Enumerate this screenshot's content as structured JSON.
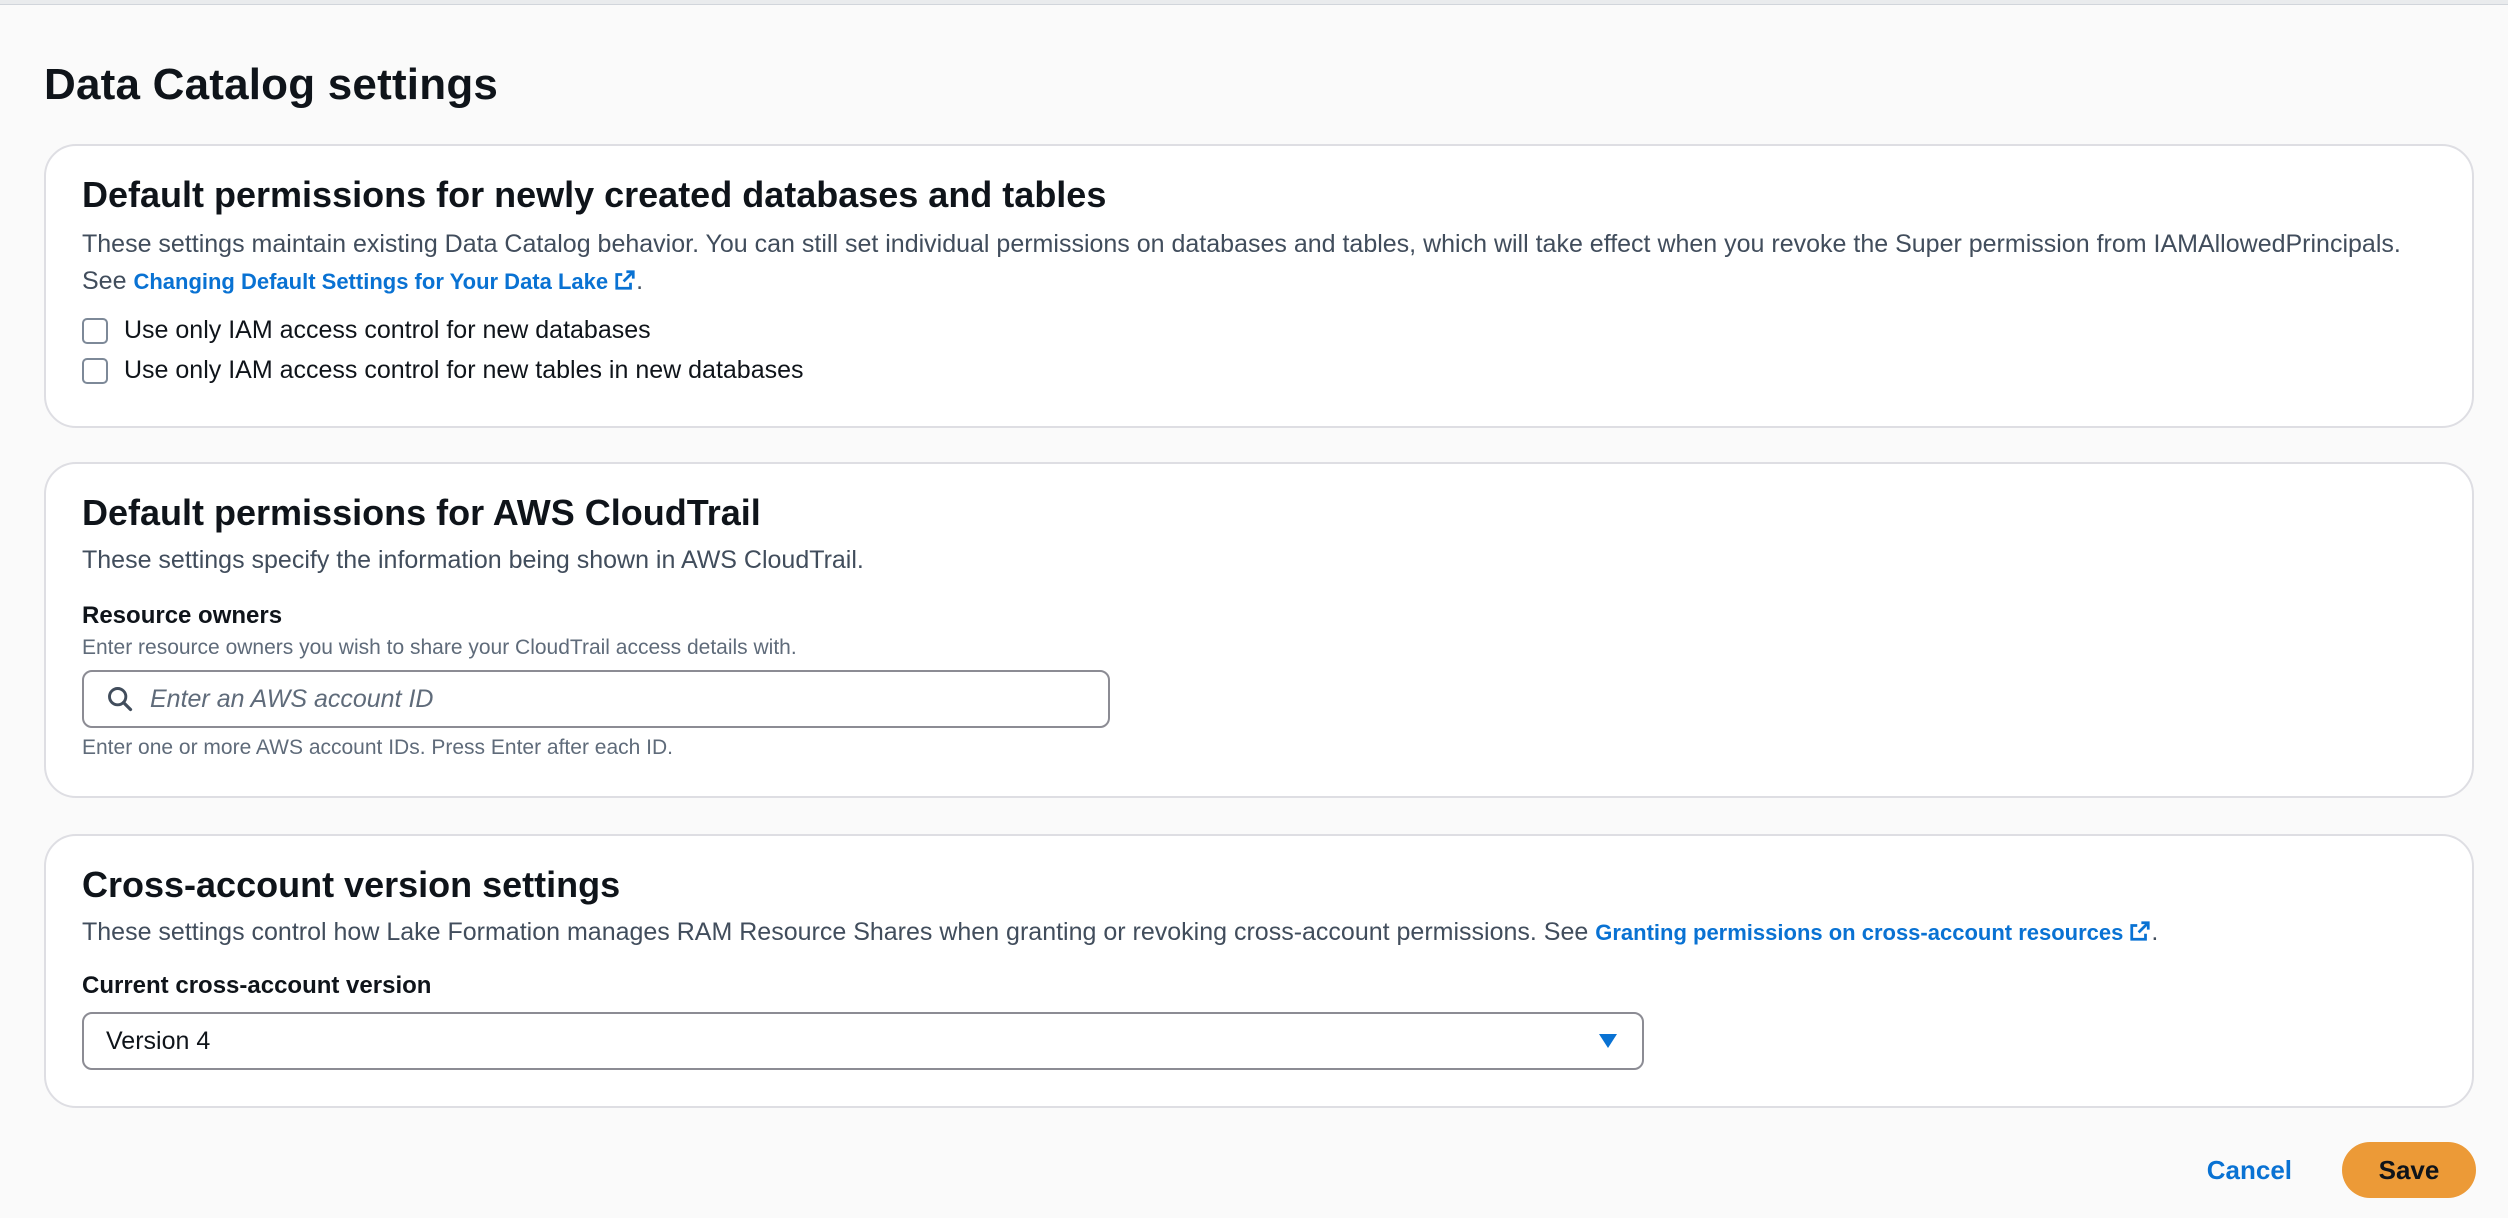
{
  "page": {
    "title": "Data Catalog settings"
  },
  "default_permissions": {
    "title": "Default permissions for newly created databases and tables",
    "description": "These settings maintain existing Data Catalog behavior. You can still set individual permissions on databases and tables, which will take effect when you revoke the Super permission from IAMAllowedPrincipals. See",
    "link_text": "Changing Default Settings for Your Data Lake",
    "link_suffix": ".",
    "checkboxes": [
      {
        "label": "Use only IAM access control for new databases",
        "checked": false
      },
      {
        "label": "Use only IAM access control for new tables in new databases",
        "checked": false
      }
    ]
  },
  "cloudtrail": {
    "title": "Default permissions for AWS CloudTrail",
    "description": "These settings specify the information being shown in AWS CloudTrail.",
    "field_label": "Resource owners",
    "field_description": "Enter resource owners you wish to share your CloudTrail access details with.",
    "input_placeholder": "Enter an AWS account ID",
    "input_value": "",
    "constraint_text": "Enter one or more AWS account IDs. Press Enter after each ID."
  },
  "cross_account": {
    "title": "Cross-account version settings",
    "description": "These settings control how Lake Formation manages RAM Resource Shares when granting or revoking cross-account permissions. See",
    "link_text": "Granting permissions on cross-account resources",
    "link_suffix": ".",
    "field_label": "Current cross-account version",
    "selected_value": "Version 4"
  },
  "actions": {
    "cancel_label": "Cancel",
    "save_label": "Save"
  },
  "colors": {
    "link": "#0972d3",
    "primary_button": "#ec9a37",
    "card_border": "#dedee3",
    "background": "#fafafa"
  },
  "icons": {
    "external_link": "external-link-icon",
    "search": "search-icon",
    "dropdown": "caret-down-icon"
  }
}
